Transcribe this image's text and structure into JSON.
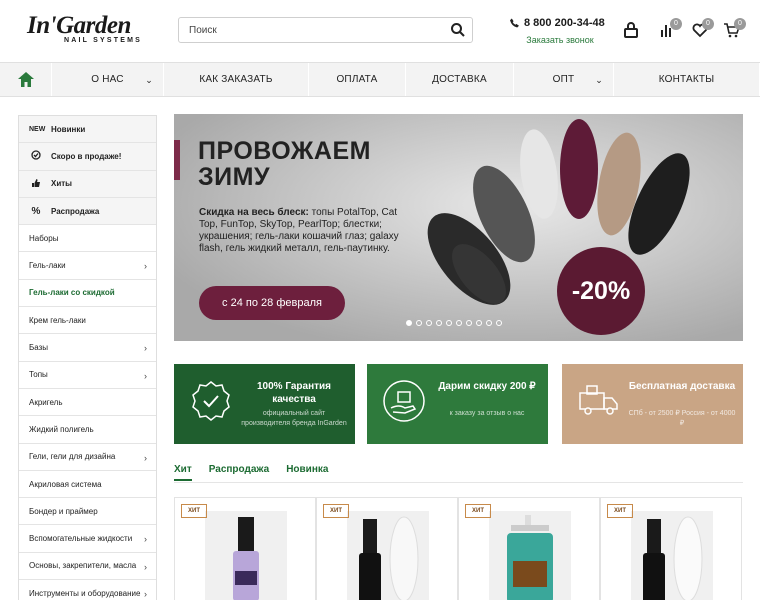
{
  "header": {
    "logo_brand": "In'Garden",
    "logo_sub": "NAIL SYSTEMS",
    "search_placeholder": "Поиск",
    "phone": "8 800 200-34-48",
    "callback": "Заказать звонок",
    "compare_count": "0",
    "wishlist_count": "0",
    "cart_count": "0"
  },
  "nav": {
    "items": [
      {
        "label": "О НАС"
      },
      {
        "label": "КАК ЗАКАЗАТЬ"
      },
      {
        "label": "ОПЛАТА"
      },
      {
        "label": "ДОСТАВКА"
      },
      {
        "label": "ОПТ"
      },
      {
        "label": "КОНТАКТЫ"
      }
    ]
  },
  "sidebar": {
    "items": [
      {
        "label": "Новинки",
        "icon": "NEW"
      },
      {
        "label": "Скоро в продаже!",
        "icon": "check-circle-icon"
      },
      {
        "label": "Хиты",
        "icon": "thumbs-up-icon"
      },
      {
        "label": "Распродажа",
        "icon": "percent-icon"
      },
      {
        "label": "Наборы"
      },
      {
        "label": "Гель-лаки"
      },
      {
        "label": "Гель-лаки со скидкой"
      },
      {
        "label": "Крем гель-лаки"
      },
      {
        "label": "Базы"
      },
      {
        "label": "Топы"
      },
      {
        "label": "Акригель"
      },
      {
        "label": "Жидкий полигель"
      },
      {
        "label": "Гели, гели для дизайна"
      },
      {
        "label": "Акриловая система"
      },
      {
        "label": "Бондер и праймер"
      },
      {
        "label": "Вспомогательные жидкости"
      },
      {
        "label": "Основы, закрепители, масла"
      },
      {
        "label": "Инструменты и оборудование"
      }
    ]
  },
  "banner": {
    "title_line1": "ПРОВОЖАЕМ",
    "title_line2": "ЗИМУ",
    "desc_bold": "Скидка на весь блеск:",
    "desc_rest": " топы PotalTop, Cat Top, FunTop, SkyTop, PearlTop; блестки; украшения; гель-лаки кошачий глаз; galaxy flash, гель жидкий металл, гель-паутинку.",
    "button": "с 24 по 28 февраля",
    "discount": "-20%"
  },
  "features": [
    {
      "title": "100% Гарантия качества",
      "sub": "официальный сайт производителя бренда InGarden",
      "color": "#1f5e2e"
    },
    {
      "title": "Дарим скидку 200 ₽",
      "sub": "к заказу за отзыв о нас",
      "color": "#2e7a3c"
    },
    {
      "title": "Бесплатная доставка",
      "sub": "СПб - от 2500 ₽ Россия - от 4000 ₽",
      "color": "#c9a585"
    }
  ],
  "tabs": [
    {
      "label": "Хит"
    },
    {
      "label": "Распродажа"
    },
    {
      "label": "Новинка"
    }
  ],
  "products": [
    {
      "badge": "ХИТ"
    },
    {
      "badge": "ХИТ"
    },
    {
      "badge": "ХИТ"
    },
    {
      "badge": "ХИТ"
    }
  ]
}
